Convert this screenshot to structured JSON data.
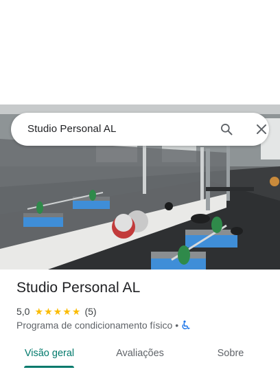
{
  "search": {
    "query": "Studio Personal AL",
    "search_icon": "search-icon",
    "close_icon": "close-icon"
  },
  "photo": {
    "subject": "gym-interior-photo"
  },
  "place": {
    "name": "Studio Personal AL",
    "rating": "5,0",
    "stars": 5,
    "review_count": "(5)",
    "category": "Programa de condicionamento físico",
    "separator": "•",
    "accessibility_icon": "wheelchair-icon"
  },
  "tabs": [
    {
      "label": "Visão geral",
      "active": true
    },
    {
      "label": "Avaliações",
      "active": false
    },
    {
      "label": "Sobre",
      "active": false
    }
  ],
  "colors": {
    "accent": "#00796b",
    "star": "#fbbc04",
    "accessibility": "#1a73e8"
  }
}
